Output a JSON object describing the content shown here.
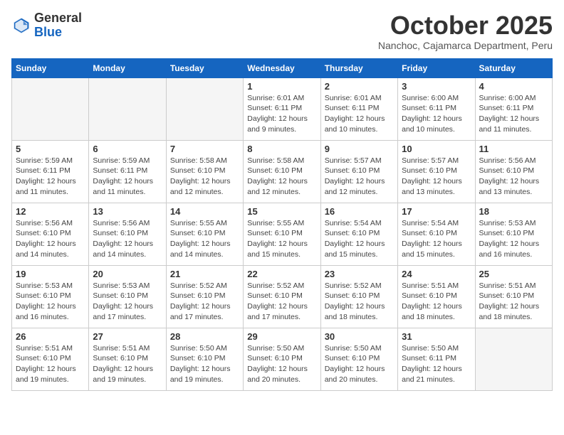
{
  "header": {
    "logo_general": "General",
    "logo_blue": "Blue",
    "month_title": "October 2025",
    "subtitle": "Nanchoc, Cajamarca Department, Peru"
  },
  "days_of_week": [
    "Sunday",
    "Monday",
    "Tuesday",
    "Wednesday",
    "Thursday",
    "Friday",
    "Saturday"
  ],
  "weeks": [
    [
      {
        "day": "",
        "info": ""
      },
      {
        "day": "",
        "info": ""
      },
      {
        "day": "",
        "info": ""
      },
      {
        "day": "1",
        "info": "Sunrise: 6:01 AM\nSunset: 6:11 PM\nDaylight: 12 hours and 9 minutes."
      },
      {
        "day": "2",
        "info": "Sunrise: 6:01 AM\nSunset: 6:11 PM\nDaylight: 12 hours and 10 minutes."
      },
      {
        "day": "3",
        "info": "Sunrise: 6:00 AM\nSunset: 6:11 PM\nDaylight: 12 hours and 10 minutes."
      },
      {
        "day": "4",
        "info": "Sunrise: 6:00 AM\nSunset: 6:11 PM\nDaylight: 12 hours and 11 minutes."
      }
    ],
    [
      {
        "day": "5",
        "info": "Sunrise: 5:59 AM\nSunset: 6:11 PM\nDaylight: 12 hours and 11 minutes."
      },
      {
        "day": "6",
        "info": "Sunrise: 5:59 AM\nSunset: 6:11 PM\nDaylight: 12 hours and 11 minutes."
      },
      {
        "day": "7",
        "info": "Sunrise: 5:58 AM\nSunset: 6:10 PM\nDaylight: 12 hours and 12 minutes."
      },
      {
        "day": "8",
        "info": "Sunrise: 5:58 AM\nSunset: 6:10 PM\nDaylight: 12 hours and 12 minutes."
      },
      {
        "day": "9",
        "info": "Sunrise: 5:57 AM\nSunset: 6:10 PM\nDaylight: 12 hours and 12 minutes."
      },
      {
        "day": "10",
        "info": "Sunrise: 5:57 AM\nSunset: 6:10 PM\nDaylight: 12 hours and 13 minutes."
      },
      {
        "day": "11",
        "info": "Sunrise: 5:56 AM\nSunset: 6:10 PM\nDaylight: 12 hours and 13 minutes."
      }
    ],
    [
      {
        "day": "12",
        "info": "Sunrise: 5:56 AM\nSunset: 6:10 PM\nDaylight: 12 hours and 14 minutes."
      },
      {
        "day": "13",
        "info": "Sunrise: 5:56 AM\nSunset: 6:10 PM\nDaylight: 12 hours and 14 minutes."
      },
      {
        "day": "14",
        "info": "Sunrise: 5:55 AM\nSunset: 6:10 PM\nDaylight: 12 hours and 14 minutes."
      },
      {
        "day": "15",
        "info": "Sunrise: 5:55 AM\nSunset: 6:10 PM\nDaylight: 12 hours and 15 minutes."
      },
      {
        "day": "16",
        "info": "Sunrise: 5:54 AM\nSunset: 6:10 PM\nDaylight: 12 hours and 15 minutes."
      },
      {
        "day": "17",
        "info": "Sunrise: 5:54 AM\nSunset: 6:10 PM\nDaylight: 12 hours and 15 minutes."
      },
      {
        "day": "18",
        "info": "Sunrise: 5:53 AM\nSunset: 6:10 PM\nDaylight: 12 hours and 16 minutes."
      }
    ],
    [
      {
        "day": "19",
        "info": "Sunrise: 5:53 AM\nSunset: 6:10 PM\nDaylight: 12 hours and 16 minutes."
      },
      {
        "day": "20",
        "info": "Sunrise: 5:53 AM\nSunset: 6:10 PM\nDaylight: 12 hours and 17 minutes."
      },
      {
        "day": "21",
        "info": "Sunrise: 5:52 AM\nSunset: 6:10 PM\nDaylight: 12 hours and 17 minutes."
      },
      {
        "day": "22",
        "info": "Sunrise: 5:52 AM\nSunset: 6:10 PM\nDaylight: 12 hours and 17 minutes."
      },
      {
        "day": "23",
        "info": "Sunrise: 5:52 AM\nSunset: 6:10 PM\nDaylight: 12 hours and 18 minutes."
      },
      {
        "day": "24",
        "info": "Sunrise: 5:51 AM\nSunset: 6:10 PM\nDaylight: 12 hours and 18 minutes."
      },
      {
        "day": "25",
        "info": "Sunrise: 5:51 AM\nSunset: 6:10 PM\nDaylight: 12 hours and 18 minutes."
      }
    ],
    [
      {
        "day": "26",
        "info": "Sunrise: 5:51 AM\nSunset: 6:10 PM\nDaylight: 12 hours and 19 minutes."
      },
      {
        "day": "27",
        "info": "Sunrise: 5:51 AM\nSunset: 6:10 PM\nDaylight: 12 hours and 19 minutes."
      },
      {
        "day": "28",
        "info": "Sunrise: 5:50 AM\nSunset: 6:10 PM\nDaylight: 12 hours and 19 minutes."
      },
      {
        "day": "29",
        "info": "Sunrise: 5:50 AM\nSunset: 6:10 PM\nDaylight: 12 hours and 20 minutes."
      },
      {
        "day": "30",
        "info": "Sunrise: 5:50 AM\nSunset: 6:10 PM\nDaylight: 12 hours and 20 minutes."
      },
      {
        "day": "31",
        "info": "Sunrise: 5:50 AM\nSunset: 6:11 PM\nDaylight: 12 hours and 21 minutes."
      },
      {
        "day": "",
        "info": ""
      }
    ]
  ]
}
